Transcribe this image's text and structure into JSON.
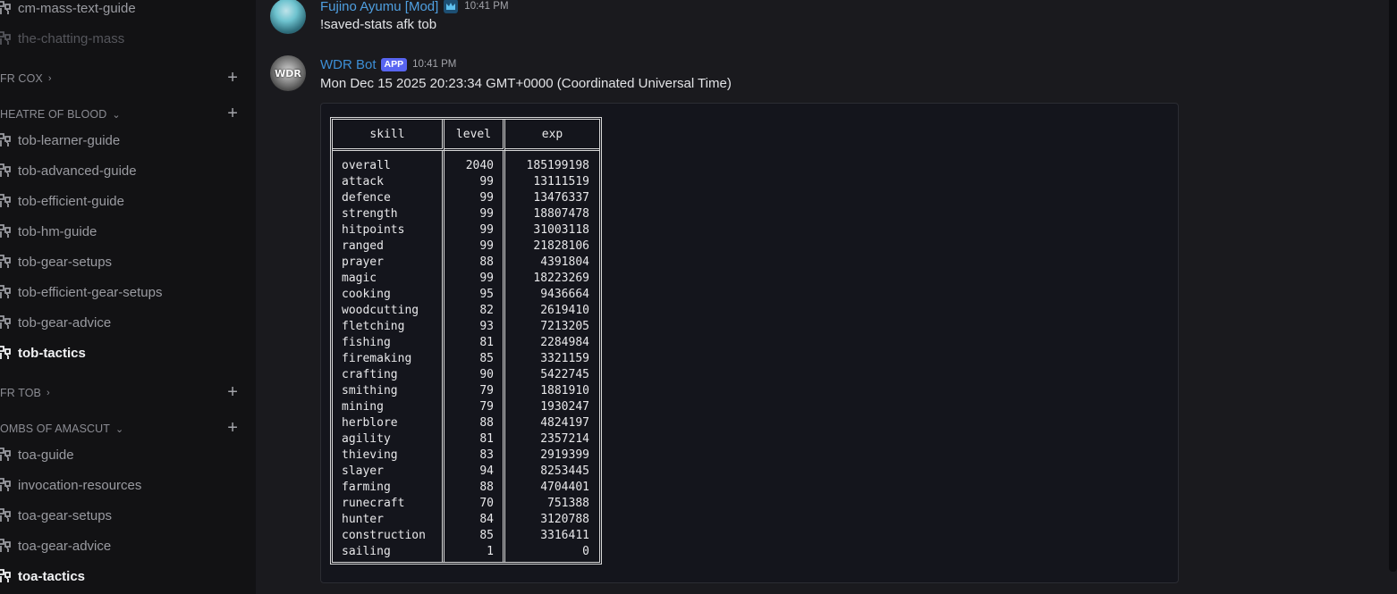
{
  "sidebar": {
    "items": [
      {
        "type": "channel",
        "label": "cm-mass-text-guide",
        "state": "normal"
      },
      {
        "type": "channel",
        "label": "the-chatting-mass",
        "state": "muted"
      },
      {
        "type": "category",
        "label": "FR COX",
        "expanded": false
      },
      {
        "type": "category",
        "label": "HEATRE OF BLOOD",
        "expanded": true
      },
      {
        "type": "channel",
        "label": "tob-learner-guide",
        "state": "normal"
      },
      {
        "type": "channel",
        "label": "tob-advanced-guide",
        "state": "normal"
      },
      {
        "type": "channel",
        "label": "tob-efficient-guide",
        "state": "normal"
      },
      {
        "type": "channel",
        "label": "tob-hm-guide",
        "state": "normal"
      },
      {
        "type": "channel",
        "label": "tob-gear-setups",
        "state": "normal"
      },
      {
        "type": "channel",
        "label": "tob-efficient-gear-setups",
        "state": "normal"
      },
      {
        "type": "channel",
        "label": "tob-gear-advice",
        "state": "normal"
      },
      {
        "type": "channel",
        "label": "tob-tactics",
        "state": "active"
      },
      {
        "type": "category",
        "label": "FR TOB",
        "expanded": false
      },
      {
        "type": "category",
        "label": "OMBS OF AMASCUT",
        "expanded": true
      },
      {
        "type": "channel",
        "label": "toa-guide",
        "state": "normal"
      },
      {
        "type": "channel",
        "label": "invocation-resources",
        "state": "normal"
      },
      {
        "type": "channel",
        "label": "toa-gear-setups",
        "state": "normal"
      },
      {
        "type": "channel",
        "label": "toa-gear-advice",
        "state": "normal"
      },
      {
        "type": "channel",
        "label": "toa-tactics",
        "state": "active"
      }
    ],
    "channel_icon": "forum-threads-icon",
    "add_icon": "plus-icon",
    "chevron_icon": "chevron-icon"
  },
  "messages": [
    {
      "author": "Fujino Ayumu [Mod]",
      "badge_icon": "moderator-crown-icon",
      "time": "10:41 PM",
      "content": "!saved-stats afk tob",
      "name_color": "#4f9fe0"
    },
    {
      "author": "WDR Bot",
      "avatar_text": "WDR",
      "tag": "APP",
      "time": "10:41 PM",
      "content": "Mon Dec 15 2025 20:23:34 GMT+0000 (Coordinated Universal Time)",
      "name_color": "#3d8fd6",
      "table": {
        "headers": {
          "skill": "skill",
          "level": "level",
          "exp": "exp"
        },
        "rows": [
          {
            "skill": "overall",
            "level": "2040",
            "exp": "185199198"
          },
          {
            "skill": "attack",
            "level": "99",
            "exp": "13111519"
          },
          {
            "skill": "defence",
            "level": "99",
            "exp": "13476337"
          },
          {
            "skill": "strength",
            "level": "99",
            "exp": "18807478"
          },
          {
            "skill": "hitpoints",
            "level": "99",
            "exp": "31003118"
          },
          {
            "skill": "ranged",
            "level": "99",
            "exp": "21828106"
          },
          {
            "skill": "prayer",
            "level": "88",
            "exp": "4391804"
          },
          {
            "skill": "magic",
            "level": "99",
            "exp": "18223269"
          },
          {
            "skill": "cooking",
            "level": "95",
            "exp": "9436664"
          },
          {
            "skill": "woodcutting",
            "level": "82",
            "exp": "2619410"
          },
          {
            "skill": "fletching",
            "level": "93",
            "exp": "7213205"
          },
          {
            "skill": "fishing",
            "level": "81",
            "exp": "2284984"
          },
          {
            "skill": "firemaking",
            "level": "85",
            "exp": "3321159"
          },
          {
            "skill": "crafting",
            "level": "90",
            "exp": "5422745"
          },
          {
            "skill": "smithing",
            "level": "79",
            "exp": "1881910"
          },
          {
            "skill": "mining",
            "level": "79",
            "exp": "1930247"
          },
          {
            "skill": "herblore",
            "level": "88",
            "exp": "4824197"
          },
          {
            "skill": "agility",
            "level": "81",
            "exp": "2357214"
          },
          {
            "skill": "thieving",
            "level": "83",
            "exp": "2919399"
          },
          {
            "skill": "slayer",
            "level": "94",
            "exp": "8253445"
          },
          {
            "skill": "farming",
            "level": "88",
            "exp": "4704401"
          },
          {
            "skill": "runecraft",
            "level": "70",
            "exp": "751388"
          },
          {
            "skill": "hunter",
            "level": "84",
            "exp": "3120788"
          },
          {
            "skill": "construction",
            "level": "85",
            "exp": "3316411"
          },
          {
            "skill": "sailing",
            "level": "1",
            "exp": "0"
          }
        ]
      }
    }
  ]
}
